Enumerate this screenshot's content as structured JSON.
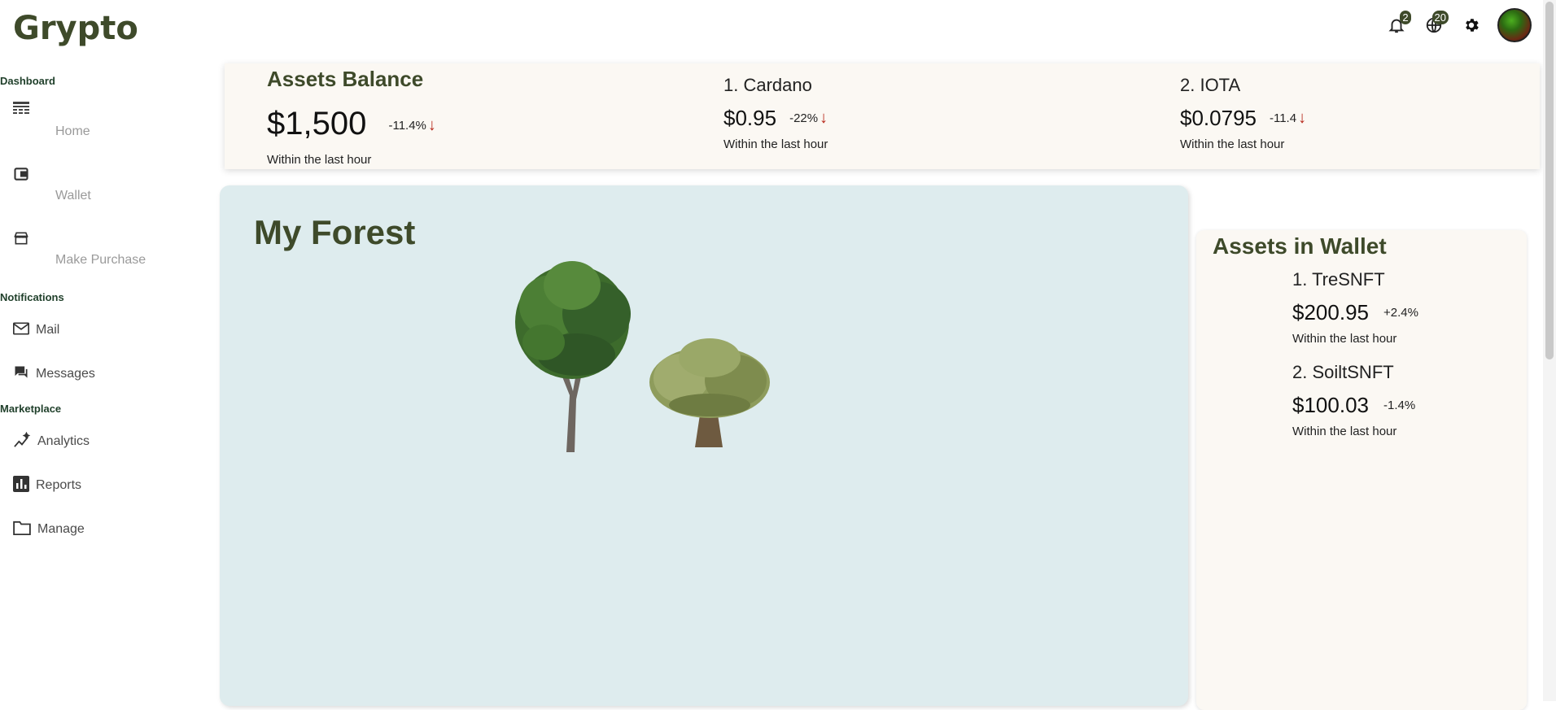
{
  "app": {
    "logo": "Grypto"
  },
  "header": {
    "notifications_count": "2",
    "globe_count": "20",
    "icons": [
      "bell-icon",
      "globe-icon",
      "gear-icon",
      "avatar"
    ]
  },
  "sidebar": {
    "dashboard_title": "Dashboard",
    "dashboard_items": [
      {
        "label": "Home",
        "icon": "dashboard-icon"
      },
      {
        "label": "Wallet",
        "icon": "wallet-icon"
      },
      {
        "label": "Make Purchase",
        "icon": "store-icon"
      }
    ],
    "notifications_title": "Notifications",
    "notifications_items": [
      {
        "label": "Mail",
        "icon": "mail-icon"
      },
      {
        "label": "Messages",
        "icon": "chat-icon"
      }
    ],
    "marketplace_title": "Marketplace",
    "marketplace_items": [
      {
        "label": "Analytics",
        "icon": "analytics-icon"
      },
      {
        "label": "Reports",
        "icon": "bar-chart-icon"
      },
      {
        "label": "Manage",
        "icon": "folder-icon"
      }
    ]
  },
  "assets_balance": {
    "title": "Assets Balance",
    "value": "$1,500",
    "change": "-11.4%",
    "note": "Within the last hour"
  },
  "coins": [
    {
      "title": "1. Cardano",
      "price": "$0.95",
      "change": "-22%",
      "note": "Within the last hour"
    },
    {
      "title": "2. IOTA",
      "price": "$0.0795",
      "change": "-11.4",
      "note": "Within the last hour"
    }
  ],
  "forest": {
    "title": "My Forest"
  },
  "wallet": {
    "title": "Assets in Wallet",
    "items": [
      {
        "title": "1. TreSNFT",
        "price": "$200.95",
        "change": "+2.4%",
        "note": "Within the last hour"
      },
      {
        "title": "2. SoiltSNFT",
        "price": "$100.03",
        "change": "-1.4%",
        "note": "Within the last hour"
      }
    ]
  },
  "colors": {
    "brand": "#3e4a2a",
    "card_bg": "#fbf8f3",
    "forest_bg": "#deecee",
    "down": "#b7281a"
  }
}
